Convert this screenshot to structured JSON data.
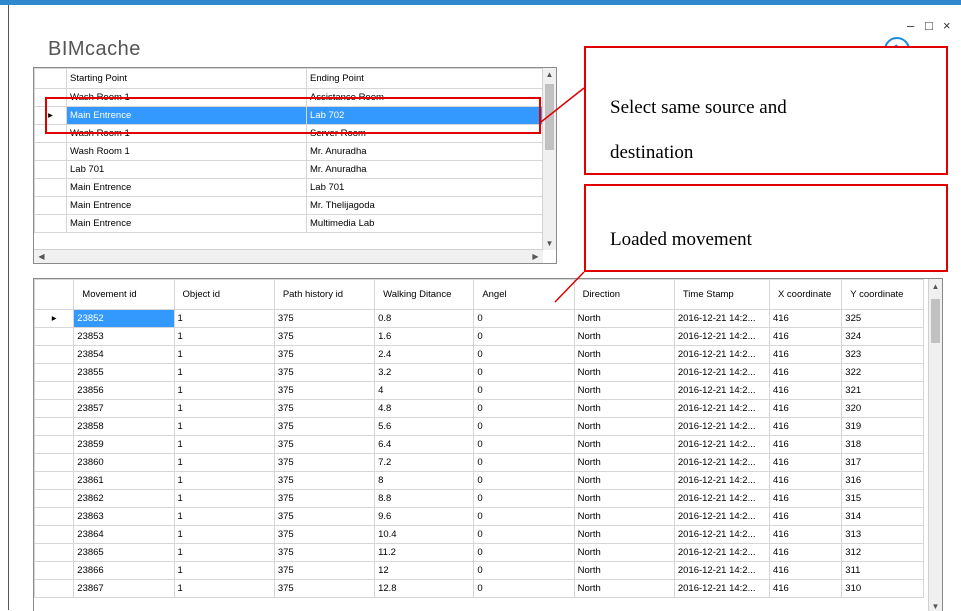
{
  "app": {
    "title": "BIMcache",
    "minimize": "–",
    "maximize": "□",
    "close": "×"
  },
  "route_grid": {
    "columns": [
      "Starting Point",
      "Ending Point"
    ],
    "rows": [
      [
        "Wash Room 1",
        "Assistance Room"
      ],
      [
        "Main Entrence",
        "Lab 702"
      ],
      [
        "Wash Room 1",
        "Server Room"
      ],
      [
        "Wash Room 1",
        "Mr. Anuradha"
      ],
      [
        "Lab 701",
        "Mr. Anuradha"
      ],
      [
        "Main Entrence",
        "Lab 701"
      ],
      [
        "Main Entrence",
        "Mr. Thelijagoda"
      ],
      [
        "Main Entrence",
        "Multimedia Lab"
      ]
    ],
    "selected_row": 1
  },
  "movement_grid": {
    "columns": [
      "Movement id",
      "Object id",
      "Path history id",
      "Walking Ditance",
      "Angel",
      "Direction",
      "Time Stamp",
      "X coordinate",
      "Y coordinate"
    ],
    "rows": [
      [
        "23852",
        "1",
        "375",
        "0.8",
        "0",
        "North",
        "2016-12-21 14:2...",
        "416",
        "325"
      ],
      [
        "23853",
        "1",
        "375",
        "1.6",
        "0",
        "North",
        "2016-12-21 14:2...",
        "416",
        "324"
      ],
      [
        "23854",
        "1",
        "375",
        "2.4",
        "0",
        "North",
        "2016-12-21 14:2...",
        "416",
        "323"
      ],
      [
        "23855",
        "1",
        "375",
        "3.2",
        "0",
        "North",
        "2016-12-21 14:2...",
        "416",
        "322"
      ],
      [
        "23856",
        "1",
        "375",
        "4",
        "0",
        "North",
        "2016-12-21 14:2...",
        "416",
        "321"
      ],
      [
        "23857",
        "1",
        "375",
        "4.8",
        "0",
        "North",
        "2016-12-21 14:2...",
        "416",
        "320"
      ],
      [
        "23858",
        "1",
        "375",
        "5.6",
        "0",
        "North",
        "2016-12-21 14:2...",
        "416",
        "319"
      ],
      [
        "23859",
        "1",
        "375",
        "6.4",
        "0",
        "North",
        "2016-12-21 14:2...",
        "416",
        "318"
      ],
      [
        "23860",
        "1",
        "375",
        "7.2",
        "0",
        "North",
        "2016-12-21 14:2...",
        "416",
        "317"
      ],
      [
        "23861",
        "1",
        "375",
        "8",
        "0",
        "North",
        "2016-12-21 14:2...",
        "416",
        "316"
      ],
      [
        "23862",
        "1",
        "375",
        "8.8",
        "0",
        "North",
        "2016-12-21 14:2...",
        "416",
        "315"
      ],
      [
        "23863",
        "1",
        "375",
        "9.6",
        "0",
        "North",
        "2016-12-21 14:2...",
        "416",
        "314"
      ],
      [
        "23864",
        "1",
        "375",
        "10.4",
        "0",
        "North",
        "2016-12-21 14:2...",
        "416",
        "313"
      ],
      [
        "23865",
        "1",
        "375",
        "11.2",
        "0",
        "North",
        "2016-12-21 14:2...",
        "416",
        "312"
      ],
      [
        "23866",
        "1",
        "375",
        "12",
        "0",
        "North",
        "2016-12-21 14:2...",
        "416",
        "311"
      ],
      [
        "23867",
        "1",
        "375",
        "12.8",
        "0",
        "North",
        "2016-12-21 14:2...",
        "416",
        "310"
      ]
    ],
    "current_row": 0
  },
  "annotations": {
    "select_text_1": "Select same source and",
    "select_text_2": "destination",
    "loaded_text": "Loaded movement"
  },
  "colors": {
    "accent": "#2f89d1",
    "selection": "#3399ff",
    "annotation": "#e00000"
  },
  "icons": {
    "back": "back-arrow-icon",
    "row_pointer": "▸",
    "scroll_up": "▲",
    "scroll_down": "▼",
    "scroll_left": "◀",
    "scroll_right": "▶"
  }
}
